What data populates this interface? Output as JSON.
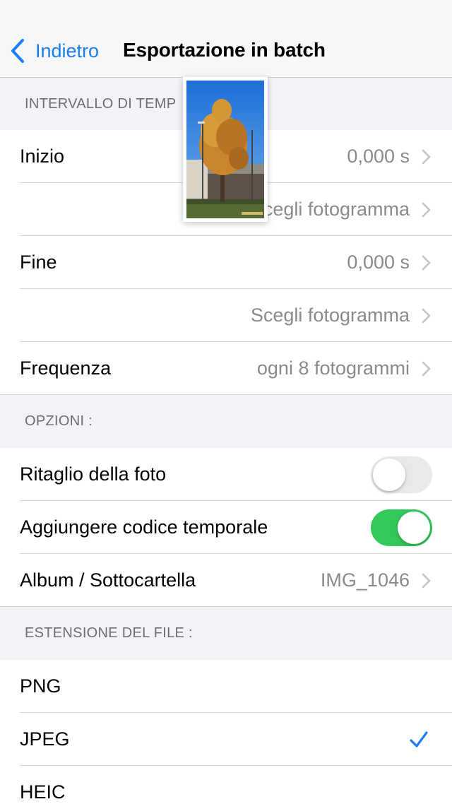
{
  "nav": {
    "back_label": "Indietro",
    "title": "Esportazione in batch"
  },
  "sections": {
    "time_interval": {
      "header": "INTERVALLO DI TEMP",
      "rows": [
        {
          "label": "Inizio",
          "value": "0,000 s"
        },
        {
          "label": "",
          "value": "Scegli fotogramma"
        },
        {
          "label": "Fine",
          "value": "0,000 s"
        },
        {
          "label": "",
          "value": "Scegli fotogramma"
        },
        {
          "label": "Frequenza",
          "value": "ogni 8 fotogrammi"
        }
      ]
    },
    "options": {
      "header": "OPZIONI :",
      "crop": {
        "label": "Ritaglio della foto",
        "on": false
      },
      "timecode": {
        "label": "Aggiungere codice temporale",
        "on": true
      },
      "album": {
        "label": "Album / Sottocartella",
        "value": "IMG_1046"
      }
    },
    "file_extension": {
      "header": "ESTENSIONE DEL FILE :",
      "options": [
        "PNG",
        "JPEG",
        "HEIC"
      ],
      "selected": "JPEG"
    }
  },
  "colors": {
    "accent": "#1a7ff0",
    "toggle_on": "#34c759",
    "secondary_text": "#8a8a8e"
  },
  "icons": {
    "back": "chevron-left-icon",
    "disclosure": "chevron-right-icon",
    "selected": "checkmark-icon"
  }
}
